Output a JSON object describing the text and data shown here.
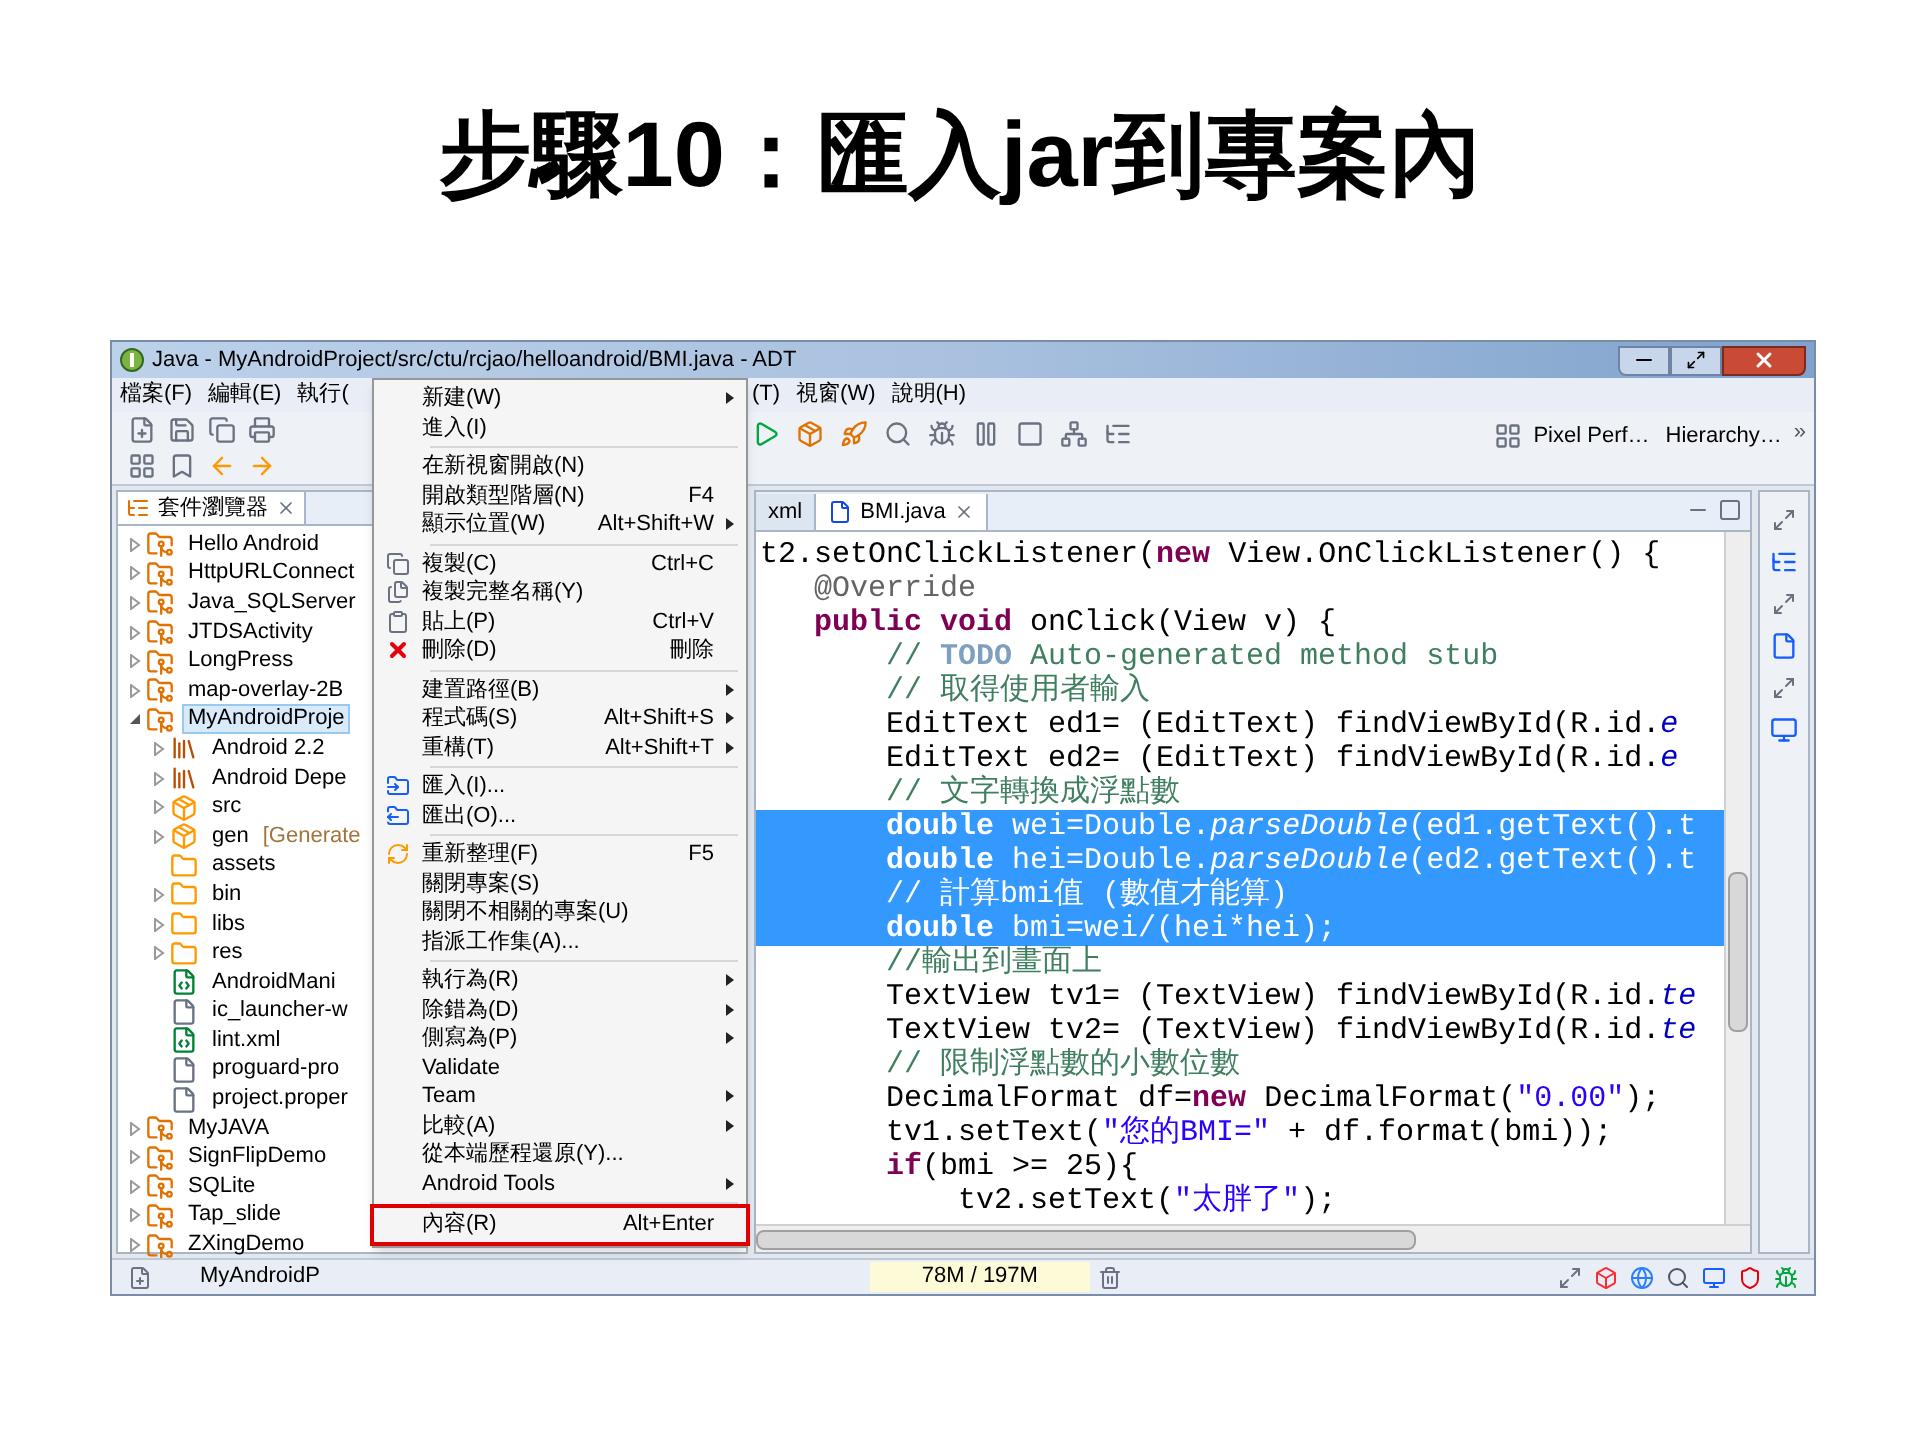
{
  "slide_title": "步驟10：匯入jar到專案內",
  "window": {
    "title": "Java - MyAndroidProject/src/ctu/rcjao/helloandroid/BMI.java - ADT"
  },
  "menubar": {
    "left": [
      "檔案(F)",
      "編輯(E)",
      "執行("
    ],
    "right": [
      "(T)",
      "視窗(W)",
      "說明(H)"
    ]
  },
  "toolbar": {
    "buttons": [
      {
        "label": "Pixel Perf…"
      },
      {
        "label": "Hierarchy…"
      }
    ],
    "overflow": "»"
  },
  "explorer": {
    "tab": {
      "label": "套件瀏覽器"
    },
    "items": [
      {
        "label": "Hello Android",
        "kind": "project",
        "expanded": false,
        "selected": false
      },
      {
        "label": "HttpURLConnect",
        "kind": "project",
        "expanded": false,
        "selected": false
      },
      {
        "label": "Java_SQLServer",
        "kind": "project",
        "expanded": false,
        "selected": false
      },
      {
        "label": "JTDSActivity",
        "kind": "project",
        "expanded": false,
        "selected": false
      },
      {
        "label": "LongPress",
        "kind": "project",
        "expanded": false,
        "selected": false
      },
      {
        "label": "map-overlay-2B",
        "kind": "project",
        "expanded": false,
        "selected": false
      },
      {
        "label": "MyAndroidProje",
        "kind": "project",
        "expanded": true,
        "selected": true,
        "children": [
          {
            "label": "Android 2.2",
            "kind": "library",
            "expanded": false,
            "selected": false
          },
          {
            "label": "Android Depe",
            "kind": "library",
            "expanded": false,
            "selected": false
          },
          {
            "label": "src",
            "kind": "package",
            "expanded": false,
            "selected": false
          },
          {
            "label": "gen",
            "note": "[Generate",
            "kind": "package",
            "expanded": false,
            "selected": false
          },
          {
            "label": "assets",
            "kind": "folder",
            "selected": false
          },
          {
            "label": "bin",
            "kind": "folder",
            "expanded": false,
            "selected": false
          },
          {
            "label": "libs",
            "kind": "folder",
            "expanded": false,
            "selected": false
          },
          {
            "label": "res",
            "kind": "folder",
            "expanded": false,
            "selected": false
          },
          {
            "label": "AndroidMani",
            "kind": "xml",
            "selected": false
          },
          {
            "label": "ic_launcher-w",
            "kind": "file",
            "selected": false
          },
          {
            "label": "lint.xml",
            "kind": "xml",
            "selected": false
          },
          {
            "label": "proguard-pro",
            "kind": "file",
            "selected": false
          },
          {
            "label": "project.proper",
            "kind": "file",
            "selected": false
          }
        ]
      },
      {
        "label": "MyJAVA",
        "kind": "project",
        "expanded": false,
        "selected": false
      },
      {
        "label": "SignFlipDemo",
        "kind": "project",
        "expanded": false,
        "selected": false
      },
      {
        "label": "SQLite",
        "kind": "project",
        "expanded": false,
        "selected": false
      },
      {
        "label": "Tap_slide",
        "kind": "project",
        "expanded": false,
        "selected": false
      },
      {
        "label": "ZXingDemo",
        "kind": "project",
        "expanded": false,
        "selected": false
      }
    ]
  },
  "editor": {
    "tabs": [
      {
        "label": "xml",
        "selected": false
      },
      {
        "label": "BMI.java",
        "selected": true
      }
    ],
    "lines": [
      {
        "selected": false,
        "segments": [
          {
            "kind": "plain",
            "text": "t2.setOnClickListener("
          },
          {
            "kind": "keyword",
            "text": "new"
          },
          {
            "kind": "plain",
            "text": " View.OnClickListener() {"
          }
        ]
      },
      {
        "selected": false,
        "segments": [
          {
            "kind": "annotation",
            "text": "   @Override"
          }
        ]
      },
      {
        "selected": false,
        "segments": [
          {
            "kind": "keyword",
            "text": "   public void"
          },
          {
            "kind": "plain",
            "text": " onClick(View v) {"
          }
        ]
      },
      {
        "selected": false,
        "segments": [
          {
            "kind": "comment",
            "text": "       // "
          },
          {
            "kind": "todo",
            "text": "TODO"
          },
          {
            "kind": "comment",
            "text": " Auto-generated method stub"
          }
        ]
      },
      {
        "selected": false,
        "segments": [
          {
            "kind": "comment",
            "text": "       // 取得使用者輸入"
          }
        ]
      },
      {
        "selected": false,
        "segments": [
          {
            "kind": "plain",
            "text": "       EditText ed1= (EditText) findViewById(R.id."
          },
          {
            "kind": "field",
            "text": "e"
          }
        ]
      },
      {
        "selected": false,
        "segments": [
          {
            "kind": "plain",
            "text": "       EditText ed2= (EditText) findViewById(R.id."
          },
          {
            "kind": "field",
            "text": "e"
          }
        ]
      },
      {
        "selected": false,
        "segments": [
          {
            "kind": "comment",
            "text": "       // 文字轉換成浮點數"
          }
        ]
      },
      {
        "selected": true,
        "segments": [
          {
            "kind": "keyword",
            "text": "       double"
          },
          {
            "kind": "plain",
            "text": " wei=Double."
          },
          {
            "kind": "italic",
            "text": "parseDouble"
          },
          {
            "kind": "plain",
            "text": "(ed1.getText().t"
          }
        ]
      },
      {
        "selected": true,
        "segments": [
          {
            "kind": "keyword",
            "text": "       double"
          },
          {
            "kind": "plain",
            "text": " hei=Double."
          },
          {
            "kind": "italic",
            "text": "parseDouble"
          },
          {
            "kind": "plain",
            "text": "(ed2.getText().t"
          }
        ]
      },
      {
        "selected": true,
        "segments": [
          {
            "kind": "comment",
            "text": "       // 計算bmi值 (數值才能算)"
          }
        ]
      },
      {
        "selected": true,
        "segments": [
          {
            "kind": "keyword",
            "text": "       double"
          },
          {
            "kind": "plain",
            "text": " bmi=wei/(hei*hei);"
          }
        ]
      },
      {
        "selected": false,
        "segments": [
          {
            "kind": "comment",
            "text": "       //輸出到畫面上"
          }
        ]
      },
      {
        "selected": false,
        "segments": [
          {
            "kind": "plain",
            "text": "       TextView tv1= (TextView) findViewById(R.id."
          },
          {
            "kind": "field",
            "text": "te"
          }
        ]
      },
      {
        "selected": false,
        "segments": [
          {
            "kind": "plain",
            "text": "       TextView tv2= (TextView) findViewById(R.id."
          },
          {
            "kind": "field",
            "text": "te"
          }
        ]
      },
      {
        "selected": false,
        "segments": [
          {
            "kind": "comment",
            "text": "       // 限制浮點數的小數位數"
          }
        ]
      },
      {
        "selected": false,
        "segments": [
          {
            "kind": "plain",
            "text": "       DecimalFormat df="
          },
          {
            "kind": "keyword",
            "text": "new"
          },
          {
            "kind": "plain",
            "text": " DecimalFormat("
          },
          {
            "kind": "string",
            "text": "\"0.00\""
          },
          {
            "kind": "plain",
            "text": ");"
          }
        ]
      },
      {
        "selected": false,
        "segments": [
          {
            "kind": "plain",
            "text": "       tv1.setText("
          },
          {
            "kind": "string",
            "text": "\"您的BMI=\""
          },
          {
            "kind": "plain",
            "text": " + df.format(bmi));"
          }
        ]
      },
      {
        "selected": false,
        "segments": [
          {
            "kind": "keyword",
            "text": "       if"
          },
          {
            "kind": "plain",
            "text": "(bmi >= 25){"
          }
        ]
      },
      {
        "selected": false,
        "segments": [
          {
            "kind": "plain",
            "text": "           tv2.setText("
          },
          {
            "kind": "string",
            "text": "\"太胖了\""
          },
          {
            "kind": "plain",
            "text": ");"
          }
        ]
      }
    ]
  },
  "context_menu": {
    "items": [
      {
        "kind": "item",
        "label": "新建(W)",
        "submenu": true,
        "highlighted": false
      },
      {
        "kind": "item",
        "label": "進入(I)",
        "highlighted": false
      },
      {
        "kind": "separator"
      },
      {
        "kind": "item",
        "label": "在新視窗開啟(N)",
        "highlighted": false
      },
      {
        "kind": "item",
        "label": "開啟類型階層(N)",
        "shortcut": "F4",
        "highlighted": false
      },
      {
        "kind": "item",
        "label": "顯示位置(W)",
        "shortcut": "Alt+Shift+W",
        "submenu": true,
        "highlighted": false
      },
      {
        "kind": "separator"
      },
      {
        "kind": "item",
        "label": "複製(C)",
        "shortcut": "Ctrl+C",
        "highlighted": false
      },
      {
        "kind": "item",
        "label": "複製完整名稱(Y)",
        "highlighted": false
      },
      {
        "kind": "item",
        "label": "貼上(P)",
        "shortcut": "Ctrl+V",
        "highlighted": false
      },
      {
        "kind": "item",
        "label": "刪除(D)",
        "shortcut": "刪除",
        "highlighted": false
      },
      {
        "kind": "separator"
      },
      {
        "kind": "item",
        "label": "建置路徑(B)",
        "submenu": true,
        "highlighted": false
      },
      {
        "kind": "item",
        "label": "程式碼(S)",
        "shortcut": "Alt+Shift+S",
        "submenu": true,
        "highlighted": false
      },
      {
        "kind": "item",
        "label": "重構(T)",
        "shortcut": "Alt+Shift+T",
        "submenu": true,
        "highlighted": false
      },
      {
        "kind": "separator"
      },
      {
        "kind": "item",
        "label": "匯入(I)...",
        "highlighted": false
      },
      {
        "kind": "item",
        "label": "匯出(O)...",
        "highlighted": false
      },
      {
        "kind": "separator"
      },
      {
        "kind": "item",
        "label": "重新整理(F)",
        "shortcut": "F5",
        "highlighted": false
      },
      {
        "kind": "item",
        "label": "關閉專案(S)",
        "highlighted": false
      },
      {
        "kind": "item",
        "label": "關閉不相關的專案(U)",
        "highlighted": false
      },
      {
        "kind": "item",
        "label": "指派工作集(A)...",
        "highlighted": false
      },
      {
        "kind": "separator"
      },
      {
        "kind": "item",
        "label": "執行為(R)",
        "submenu": true,
        "highlighted": false
      },
      {
        "kind": "item",
        "label": "除錯為(D)",
        "submenu": true,
        "highlighted": false
      },
      {
        "kind": "item",
        "label": "側寫為(P)",
        "submenu": true,
        "highlighted": false
      },
      {
        "kind": "item",
        "label": "Validate",
        "highlighted": false
      },
      {
        "kind": "item",
        "label": "Team",
        "submenu": true,
        "highlighted": false
      },
      {
        "kind": "item",
        "label": "比較(A)",
        "submenu": true,
        "highlighted": false
      },
      {
        "kind": "item",
        "label": "從本端歷程還原(Y)...",
        "highlighted": false
      },
      {
        "kind": "item",
        "label": "Android Tools",
        "submenu": true,
        "highlighted": false
      },
      {
        "kind": "separator"
      },
      {
        "kind": "item",
        "label": "內容(R)",
        "shortcut": "Alt+Enter",
        "highlighted": true
      }
    ]
  },
  "status_bar": {
    "project": "MyAndroidP",
    "memory": "78M / 197M"
  }
}
